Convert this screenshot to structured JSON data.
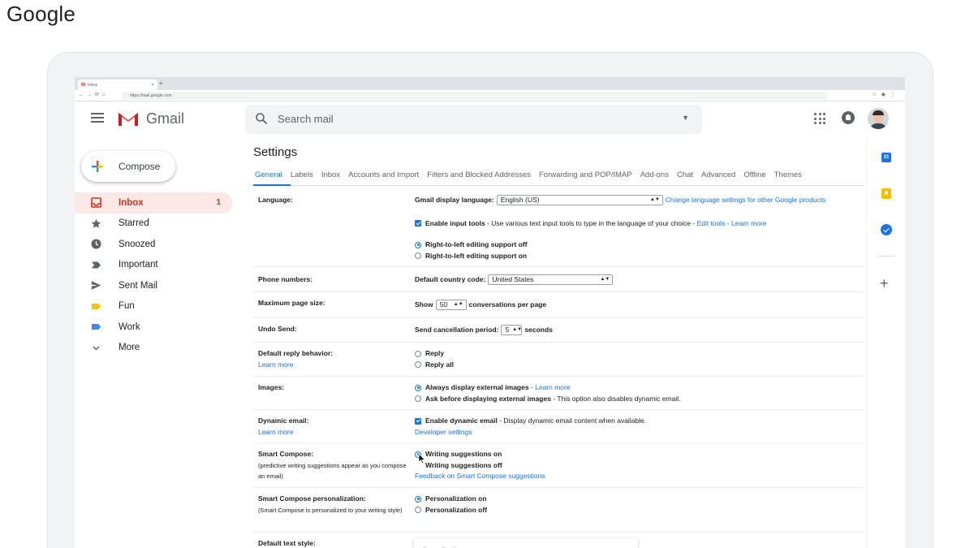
{
  "brand": "Google",
  "browser": {
    "tab_title": "Inbox",
    "tab_close": "×",
    "new_tab": "+",
    "url": "https://mail.google.com"
  },
  "header": {
    "logo_text": "Gmail",
    "search_placeholder": "Search mail"
  },
  "sidebar": {
    "compose_label": "Compose",
    "items": [
      {
        "label": "Inbox",
        "count": "1",
        "icon": "inbox-icon"
      },
      {
        "label": "Starred",
        "count": "",
        "icon": "star-icon"
      },
      {
        "label": "Snoozed",
        "count": "",
        "icon": "clock-icon"
      },
      {
        "label": "Important",
        "count": "",
        "icon": "important-icon"
      },
      {
        "label": "Sent Mail",
        "count": "",
        "icon": "send-icon"
      },
      {
        "label": "Fun",
        "count": "",
        "icon": "label-icon"
      },
      {
        "label": "Work",
        "count": "",
        "icon": "label-icon"
      },
      {
        "label": "More",
        "count": "",
        "icon": "chevron-down-icon"
      }
    ]
  },
  "settings": {
    "title": "Settings",
    "tabs": [
      "General",
      "Labels",
      "Inbox",
      "Accounts and Import",
      "Filters and Blocked Addresses",
      "Forwarding and POP/IMAP",
      "Add-ons",
      "Chat",
      "Advanced",
      "Offline",
      "Themes"
    ],
    "language": {
      "label": "Language:",
      "display_label": "Gmail display language:",
      "display_value": "English (US)",
      "change_link": "Change language settings for other Google products",
      "input_tools_bold": "Enable input tools",
      "input_tools_text": " - Use various text input tools to type in the language of your choice - ",
      "edit_tools": "Edit tools",
      "dash": " - ",
      "learn_more": "Learn more",
      "rtl_off": "Right-to-left editing support off",
      "rtl_on": "Right-to-left editing support on"
    },
    "phone": {
      "label": "Phone numbers:",
      "country_label": "Default country code:",
      "country_value": "United States"
    },
    "page_size": {
      "label": "Maximum page size:",
      "show": "Show",
      "value": "50",
      "suffix": "conversations per page"
    },
    "undo_send": {
      "label": "Undo Send:",
      "period_label": "Send cancellation period:",
      "value": "5",
      "suffix": "seconds"
    },
    "reply": {
      "label": "Default reply behavior:",
      "learn_more": "Learn more",
      "opt1": "Reply",
      "opt2": "Reply all"
    },
    "images": {
      "label": "Images:",
      "opt1_bold": "Always display external images",
      "opt1_sep": " - ",
      "opt1_link": "Learn more",
      "opt2_bold": "Ask before displaying external images",
      "opt2_text": " - This option also disables dynamic email."
    },
    "dynamic": {
      "label": "Dynamic email:",
      "learn_more": "Learn more",
      "opt_bold": "Enable dynamic email",
      "opt_text": " - Display dynamic email content when available.",
      "dev_link": "Developer settings"
    },
    "smart_compose": {
      "label": "Smart Compose:",
      "sub": "(predictive writing suggestions appear as you compose an email)",
      "opt1": "Writing suggestions on",
      "opt2": "Writing suggestions off",
      "feedback": "Feedback on Smart Compose suggestions"
    },
    "personalization": {
      "label": "Smart Compose personalization:",
      "sub": "(Smart Compose is personalized to your writing style)",
      "opt1": "Personalization on",
      "opt2": "Personalization off"
    },
    "text_style": {
      "label": "Default text style:",
      "font": "Sans Serif"
    }
  },
  "colors": {
    "accent": "#1a73e8",
    "gmail_red": "#d93025",
    "active_bg": "#fce8e6"
  }
}
